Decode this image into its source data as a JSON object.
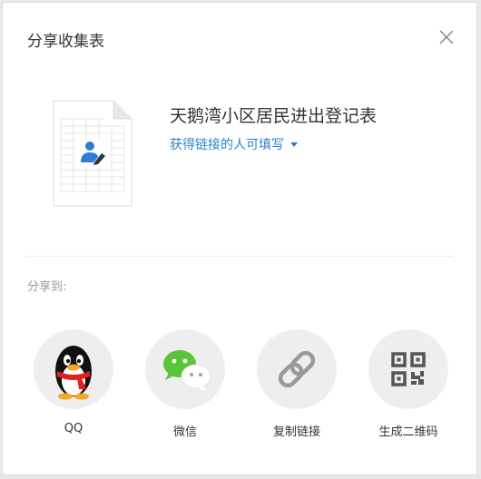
{
  "dialog": {
    "title": "分享收集表"
  },
  "file": {
    "name": "天鹅湾小区居民进出登记表",
    "permission": "获得链接的人可填写"
  },
  "share": {
    "label": "分享到:",
    "options": [
      {
        "label": "QQ",
        "icon": "qq-penguin-icon"
      },
      {
        "label": "微信",
        "icon": "wechat-icon"
      },
      {
        "label": "复制链接",
        "icon": "link-icon"
      },
      {
        "label": "生成二维码",
        "icon": "qr-code-icon"
      }
    ]
  },
  "colors": {
    "accent": "#2a7fd4",
    "wechat_green": "#5ac43b",
    "circle_bg": "#eeeeee"
  }
}
